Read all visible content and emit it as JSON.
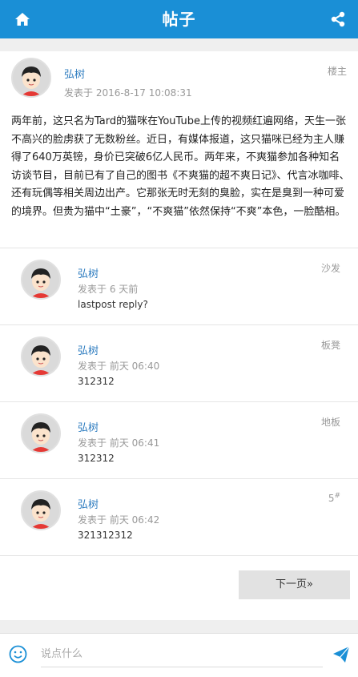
{
  "header": {
    "title": "帖子",
    "left_icon": "home-icon",
    "right_icon": "share-icon"
  },
  "post": {
    "author": "弘树",
    "time": "发表于 2016-8-17 10:08:31",
    "floor": "楼主",
    "body": "两年前，这只名为Tard的猫咪在YouTube上传的视频红遍网络，天生一张不高兴的脸虏获了无数粉丝。近日，有媒体报道，这只猫咪已经为主人赚得了640万英镑，身价已突破6亿人民币。两年来，不爽猫参加各种知名访谈节目，目前已有了自己的图书《不爽猫的超不爽日记》、代言冰咖啡、还有玩偶等相关周边出产。它那张无时无刻的臭脸，实在是臭到一种可爱的境界。但贵为猫中“土豪”，“不爽猫”依然保持“不爽”本色，一脸酷相。"
  },
  "replies": [
    {
      "author": "弘树",
      "time": "发表于 6 天前",
      "text": "lastpost reply?",
      "floor": "沙发",
      "floor_sup": ""
    },
    {
      "author": "弘树",
      "time": "发表于 前天 06:40",
      "text": "312312",
      "floor": "板凳",
      "floor_sup": ""
    },
    {
      "author": "弘树",
      "time": "发表于 前天 06:41",
      "text": "312312",
      "floor": "地板",
      "floor_sup": ""
    },
    {
      "author": "弘树",
      "time": "发表于 前天 06:42",
      "text": "321312312",
      "floor": "5",
      "floor_sup": "#"
    }
  ],
  "pager": {
    "next_label": "下一页»"
  },
  "composer": {
    "placeholder": "说点什么",
    "emoji_icon": "smiley-icon",
    "send_icon": "paper-plane-icon"
  }
}
